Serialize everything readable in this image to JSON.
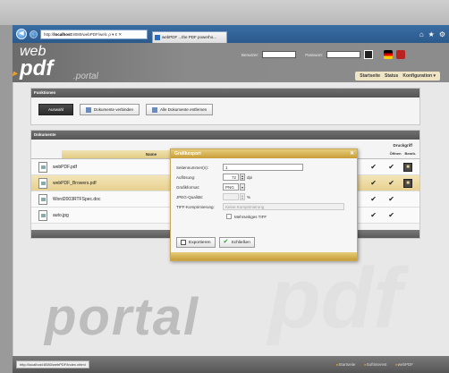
{
  "browser": {
    "url_prefix": "http://",
    "url_host": "localhost",
    "url_rest": ":8080/webPDF/welc",
    "url_controls": "ρ ▾ ¢ ✕",
    "tab_title": "webPDF ...the PDF powerho...",
    "right_icons": [
      "⌂",
      "★",
      "⚙"
    ]
  },
  "header": {
    "logo_web": "web",
    "logo_pdf": "pdf",
    "logo_portal": ".portal",
    "username_label": "Benutzer:",
    "password_label": "Passwort:",
    "nav": [
      "Startseite",
      "Status",
      "Konfiguration ▾"
    ]
  },
  "funktionen": {
    "title": "Funktionen",
    "buttons": [
      "Auswahl",
      "Dokumente verbinden",
      "Alle Dokumente entfernen"
    ]
  },
  "dokumente": {
    "title": "Dokumente",
    "col_name": "Name",
    "col_druck": "Druckgriff",
    "col_sub": [
      "Öffnen",
      "Bearb."
    ],
    "rows": [
      {
        "name": "webPDF.pdf",
        "selected": false,
        "checks": 2,
        "lock": true
      },
      {
        "name": "webPDF_Browers.pdf",
        "selected": true,
        "checks": 2,
        "lock": true
      },
      {
        "name": "Word2003RTFSpec.doc",
        "selected": false,
        "checks": 2,
        "lock": false
      },
      {
        "name": "auto.jpg",
        "selected": false,
        "checks": 2,
        "lock": false
      }
    ]
  },
  "dialog": {
    "title": "Grafikexport",
    "close": "✕",
    "fields": {
      "seiten_label": "Seitennummer(n):",
      "seiten_value": "1",
      "aufl_label": "Auflösung:",
      "aufl_value": "72",
      "aufl_unit": "dpi",
      "format_label": "Grafikformat:",
      "format_value": "PNG",
      "jpeg_label": "JPEG-Qualität:",
      "jpeg_unit": "%",
      "tiff_label": "TIFF-Komprimierung:",
      "tiff_value": "Keine Komprimierung",
      "mehrseitig_label": "Mehrseitiges TIFF"
    },
    "buttons": {
      "export": "Exportieren",
      "close": "Schließen"
    }
  },
  "background": {
    "big_logo": "portal",
    "ghost": "pdf"
  },
  "footer": {
    "status_url": "http://localhost:8080/webPDF/index.xhtml",
    "nav": [
      "Startseite",
      "Softinterest",
      "webPDF"
    ]
  }
}
